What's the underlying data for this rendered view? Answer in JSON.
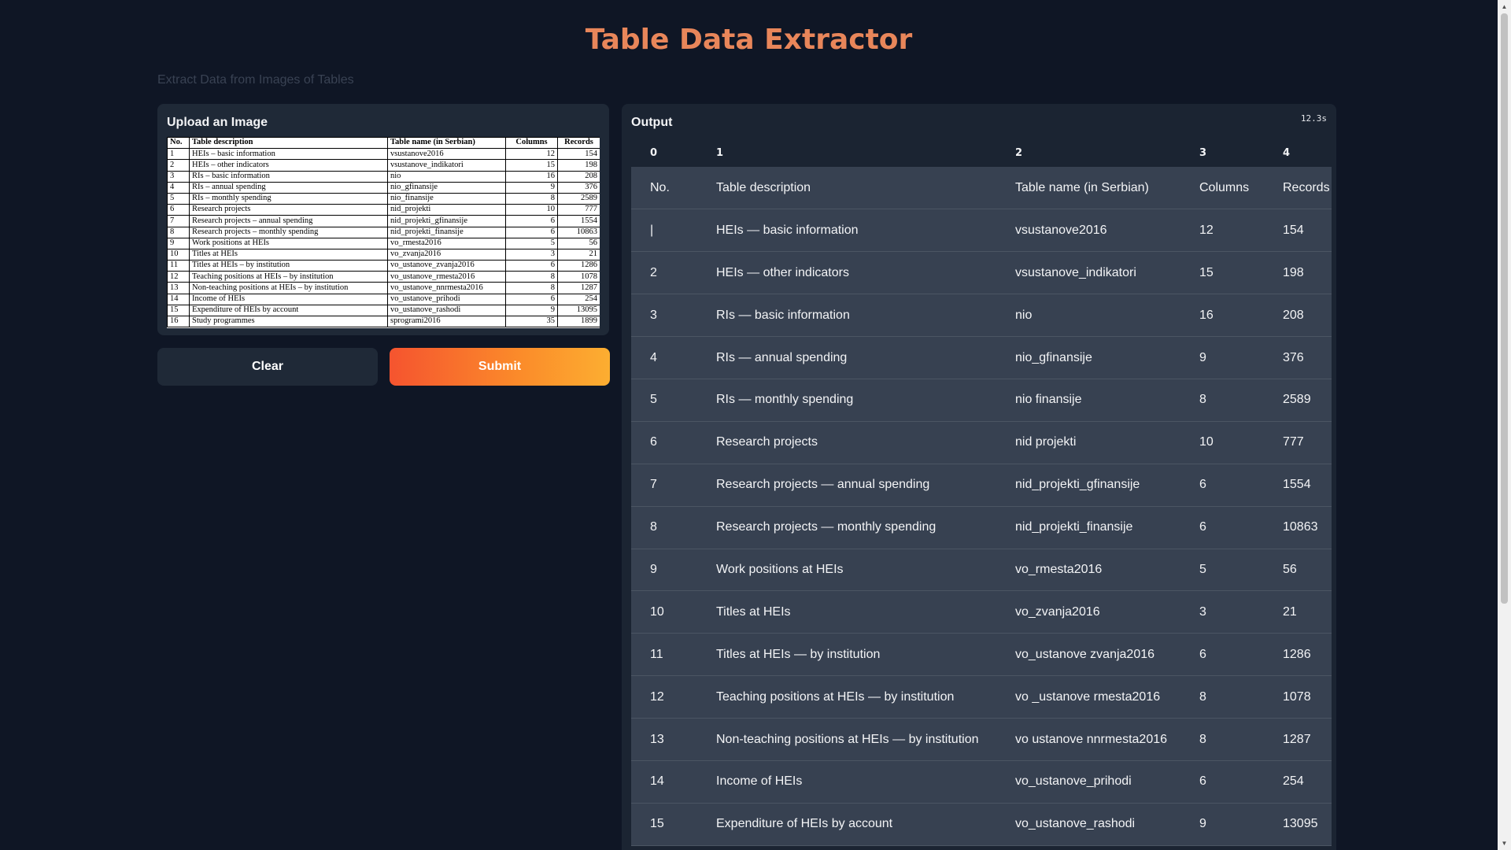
{
  "header": {
    "title": "Table Data Extractor",
    "subtitle": "Extract Data from Images of Tables"
  },
  "upload": {
    "label": "Upload an Image",
    "image_headers": [
      "No.",
      "Table description",
      "Table name (in Serbian)",
      "Columns",
      "Records"
    ],
    "image_rows": [
      [
        "1",
        "HEIs – basic information",
        "vsustanove2016",
        "12",
        "154"
      ],
      [
        "2",
        "HEIs – other indicators",
        "vsustanove_indikatori",
        "15",
        "198"
      ],
      [
        "3",
        "RIs – basic information",
        "nio",
        "16",
        "208"
      ],
      [
        "4",
        "RIs – annual spending",
        "nio_gfinansije",
        "9",
        "376"
      ],
      [
        "5",
        "RIs – monthly spending",
        "nio_finansije",
        "8",
        "2589"
      ],
      [
        "6",
        "Research projects",
        "nid_projekti",
        "10",
        "777"
      ],
      [
        "7",
        "Research projects – annual spending",
        "nid_projekti_gfinansije",
        "6",
        "1554"
      ],
      [
        "8",
        "Research projects – monthly spending",
        "nid_projekti_finansije",
        "6",
        "10863"
      ],
      [
        "9",
        "Work positions at HEIs",
        "vo_rmesta2016",
        "5",
        "56"
      ],
      [
        "10",
        "Titles at HEIs",
        "vo_zvanja2016",
        "3",
        "21"
      ],
      [
        "11",
        "Titles at HEIs – by institution",
        "vo_ustanove_zvanja2016",
        "6",
        "1286"
      ],
      [
        "12",
        "Teaching positions at HEIs – by institution",
        "vo_ustanove_rmesta2016",
        "8",
        "1078"
      ],
      [
        "13",
        "Non-teaching positions at HEIs – by institution",
        "vo_ustanove_nnrmesta2016",
        "8",
        "1287"
      ],
      [
        "14",
        "Income of HEIs",
        "vo_ustanove_prihodi",
        "6",
        "254"
      ],
      [
        "15",
        "Expenditure of HEIs by account",
        "vo_ustanove_rashodi",
        "9",
        "13095"
      ],
      [
        "16",
        "Study programmes",
        "sprogrami2016",
        "35",
        "1899"
      ]
    ]
  },
  "buttons": {
    "clear": "Clear",
    "submit": "Submit"
  },
  "output": {
    "label": "Output",
    "timer": "12.3s",
    "column_indices": [
      "0",
      "1",
      "2",
      "3",
      "4"
    ],
    "rows": [
      [
        "No.",
        "Table description",
        "Table name (in Serbian)",
        "Columns",
        "Records"
      ],
      [
        "|",
        "HEIs — basic information",
        "vsustanove2016",
        "12",
        "154"
      ],
      [
        "2",
        "HEIs — other indicators",
        "vsustanove_indikatori",
        "15",
        "198"
      ],
      [
        "3",
        "RIs — basic information",
        "nio",
        "16",
        "208"
      ],
      [
        "4",
        "RIs — annual spending",
        "nio_gfinansije",
        "9",
        "376"
      ],
      [
        "5",
        "RIs — monthly spending",
        "nio finansije",
        "8",
        "2589"
      ],
      [
        "6",
        "Research projects",
        "nid projekti",
        "10",
        "777"
      ],
      [
        "7",
        "Research projects — annual spending",
        "nid_projekti_gfinansije",
        "6",
        "1554"
      ],
      [
        "8",
        "Research projects — monthly spending",
        "nid_projekti_finansije",
        "6",
        "10863"
      ],
      [
        "9",
        "Work positions at HEIs",
        "vo_rmesta2016",
        "5",
        "56"
      ],
      [
        "10",
        "Titles at HEIs",
        "vo_zvanja2016",
        "3",
        "21"
      ],
      [
        "11",
        "Titles at HEIs — by institution",
        "vo_ustanove zvanja2016",
        "6",
        "1286"
      ],
      [
        "12",
        "Teaching positions at HEIs — by institution",
        "vo _ustanove rmesta2016",
        "8",
        "1078"
      ],
      [
        "13",
        "Non-teaching positions at HEIs — by institution",
        "vo ustanove nnrmesta2016",
        "8",
        "1287"
      ],
      [
        "14",
        "Income of HEIs",
        "vo_ustanove_prihodi",
        "6",
        "254"
      ],
      [
        "15",
        "Expenditure of HEIs by account",
        "vo_ustanove_rashodi",
        "9",
        "13095"
      ]
    ]
  },
  "scrollbar": {
    "up_icon": "chevron-up-icon",
    "down_icon": "chevron-down-icon"
  }
}
